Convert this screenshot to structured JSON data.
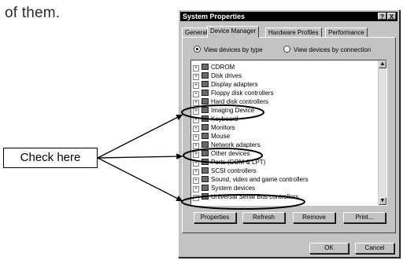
{
  "page_text": "of them.",
  "dialog": {
    "title": "System Properties",
    "help_btn": "?",
    "close_btn": "X",
    "tabs": [
      "General",
      "Device Manager",
      "Hardware Profiles",
      "Performance"
    ],
    "radio_by_type": "View devices by type",
    "radio_by_connection": "View devices by connection",
    "devices": [
      "CDROM",
      "Disk drives",
      "Display adapters",
      "Floppy disk controllers",
      "Hard disk controllers",
      "Imaging Device",
      "Keyboard",
      "Monitors",
      "Mouse",
      "Network adapters",
      "Other devices",
      "Ports (COM & LPT)",
      "SCSI controllers",
      "Sound, video and game controllers",
      "System devices",
      "Universal Serial Bus controllers"
    ],
    "buttons": {
      "properties": "Properties",
      "refresh": "Refresh",
      "remove": "Remove",
      "print": "Print..."
    },
    "ok": "OK",
    "cancel": "Cancel"
  },
  "callout": "Check here"
}
